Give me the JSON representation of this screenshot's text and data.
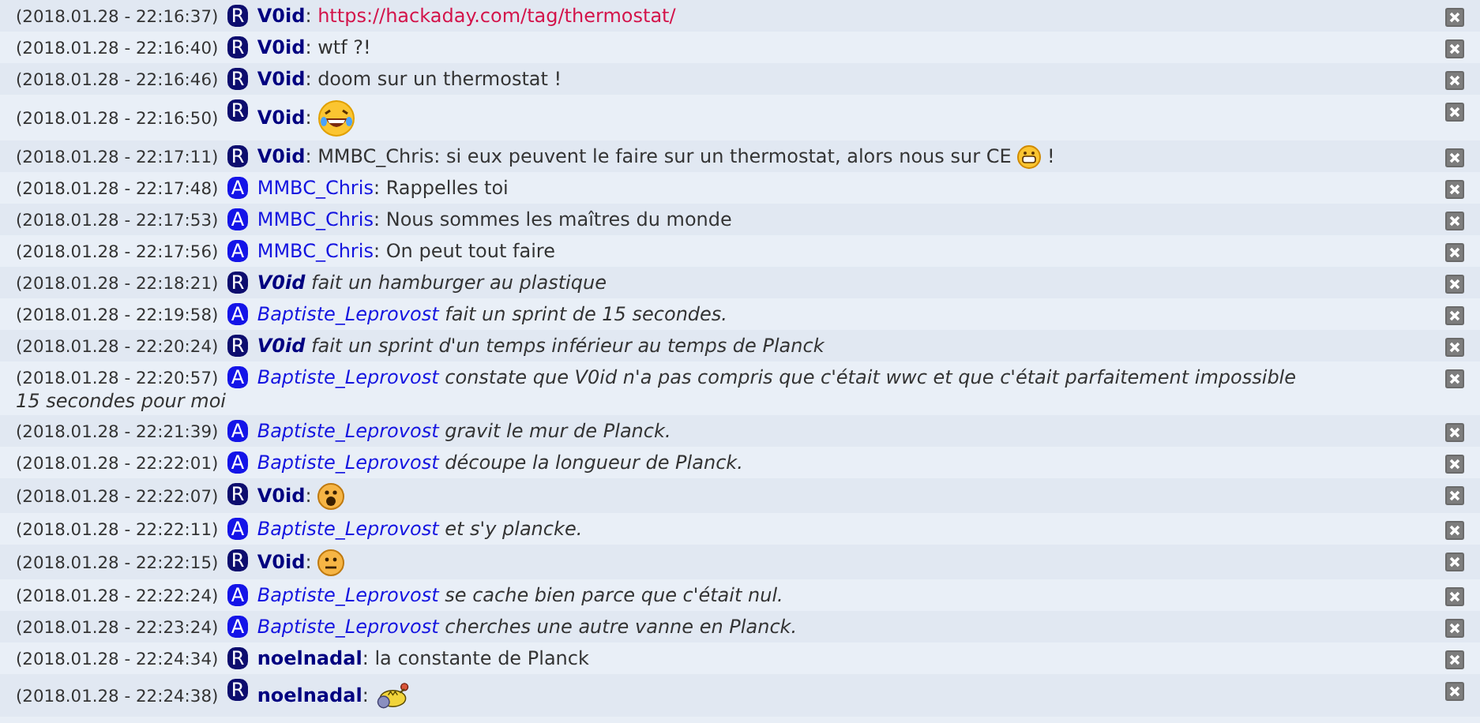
{
  "messages": [
    {
      "time": "(2018.01.28 - 22:16:37)",
      "badge": "R",
      "nick": "V0id",
      "kind": "say",
      "separator": ":",
      "parts": [
        {
          "kind": "link",
          "text": "https://hackaday.com/tag/thermostat/"
        }
      ]
    },
    {
      "time": "(2018.01.28 - 22:16:40)",
      "badge": "R",
      "nick": "V0id",
      "kind": "say",
      "separator": ":",
      "parts": [
        {
          "kind": "text",
          "text": "wtf ?!"
        }
      ]
    },
    {
      "time": "(2018.01.28 - 22:16:46)",
      "badge": "R",
      "nick": "V0id",
      "kind": "say",
      "separator": ":",
      "parts": [
        {
          "kind": "text",
          "text": "doom sur un thermostat !"
        }
      ]
    },
    {
      "time": "(2018.01.28 - 22:16:50)",
      "badge": "R",
      "nick": "V0id",
      "kind": "say",
      "separator": ":",
      "parts": [
        {
          "kind": "laughing"
        }
      ]
    },
    {
      "time": "(2018.01.28 - 22:17:11)",
      "badge": "R",
      "nick": "V0id",
      "kind": "say",
      "separator": ":",
      "parts": [
        {
          "kind": "text",
          "text": "MMBC_Chris: si eux peuvent le faire sur un thermostat, alors nous sur CE"
        },
        {
          "kind": "grinning"
        },
        {
          "kind": "text",
          "text": "!"
        }
      ]
    },
    {
      "time": "(2018.01.28 - 22:17:48)",
      "badge": "A",
      "nick": "MMBC_Chris",
      "kind": "say",
      "separator": ":",
      "parts": [
        {
          "kind": "text",
          "text": "Rappelles toi"
        }
      ]
    },
    {
      "time": "(2018.01.28 - 22:17:53)",
      "badge": "A",
      "nick": "MMBC_Chris",
      "kind": "say",
      "separator": ":",
      "parts": [
        {
          "kind": "text",
          "text": "Nous sommes les maîtres du monde"
        }
      ]
    },
    {
      "time": "(2018.01.28 - 22:17:56)",
      "badge": "A",
      "nick": "MMBC_Chris",
      "kind": "say",
      "separator": ":",
      "parts": [
        {
          "kind": "text",
          "text": "On peut tout faire"
        }
      ]
    },
    {
      "time": "(2018.01.28 - 22:18:21)",
      "badge": "R",
      "nick": "V0id",
      "kind": "action",
      "parts": [
        {
          "kind": "text",
          "text": "fait un hamburger au plastique"
        }
      ]
    },
    {
      "time": "(2018.01.28 - 22:19:58)",
      "badge": "A",
      "nick": "Baptiste_Leprovost",
      "kind": "action",
      "parts": [
        {
          "kind": "text",
          "text": "fait un sprint de 15 secondes."
        }
      ]
    },
    {
      "time": "(2018.01.28 - 22:20:24)",
      "badge": "R",
      "nick": "V0id",
      "kind": "action",
      "parts": [
        {
          "kind": "text",
          "text": "fait un sprint d'un temps inférieur au temps de Planck"
        }
      ]
    },
    {
      "time": "(2018.01.28 - 22:20:57)",
      "badge": "A",
      "nick": "Baptiste_Leprovost",
      "kind": "action",
      "parts": [
        {
          "kind": "text",
          "text": "constate que V0id n'a pas compris que c'était wwc et que c'était parfaitement impossible"
        },
        {
          "kind": "break"
        },
        {
          "kind": "text",
          "text": "15 secondes pour moi"
        }
      ]
    },
    {
      "time": "(2018.01.28 - 22:21:39)",
      "badge": "A",
      "nick": "Baptiste_Leprovost",
      "kind": "action",
      "parts": [
        {
          "kind": "text",
          "text": "gravit le mur de Planck."
        }
      ]
    },
    {
      "time": "(2018.01.28 - 22:22:01)",
      "badge": "A",
      "nick": "Baptiste_Leprovost",
      "kind": "action",
      "parts": [
        {
          "kind": "text",
          "text": "découpe la longueur de Planck."
        }
      ]
    },
    {
      "time": "(2018.01.28 - 22:22:07)",
      "badge": "R",
      "nick": "V0id",
      "kind": "say",
      "separator": ":",
      "parts": [
        {
          "kind": "shocked"
        }
      ]
    },
    {
      "time": "(2018.01.28 - 22:22:11)",
      "badge": "A",
      "nick": "Baptiste_Leprovost",
      "kind": "action",
      "parts": [
        {
          "kind": "text",
          "text": "et s'y plancke."
        }
      ]
    },
    {
      "time": "(2018.01.28 - 22:22:15)",
      "badge": "R",
      "nick": "V0id",
      "kind": "say",
      "separator": ":",
      "parts": [
        {
          "kind": "neutral"
        }
      ]
    },
    {
      "time": "(2018.01.28 - 22:22:24)",
      "badge": "A",
      "nick": "Baptiste_Leprovost",
      "kind": "action",
      "parts": [
        {
          "kind": "text",
          "text": "se cache bien parce que c'était nul."
        }
      ]
    },
    {
      "time": "(2018.01.28 - 22:23:24)",
      "badge": "A",
      "nick": "Baptiste_Leprovost",
      "kind": "action",
      "parts": [
        {
          "kind": "text",
          "text": "cherches une autre vanne en Planck."
        }
      ]
    },
    {
      "time": "(2018.01.28 - 22:24:34)",
      "badge": "R",
      "nick": "noelnadal",
      "kind": "say",
      "separator": ":",
      "parts": [
        {
          "kind": "text",
          "text": "la constante de Planck"
        }
      ]
    },
    {
      "time": "(2018.01.28 - 22:24:38)",
      "badge": "R",
      "nick": "noelnadal",
      "kind": "say",
      "separator": ":",
      "parts": [
        {
          "kind": "creature"
        }
      ]
    }
  ]
}
